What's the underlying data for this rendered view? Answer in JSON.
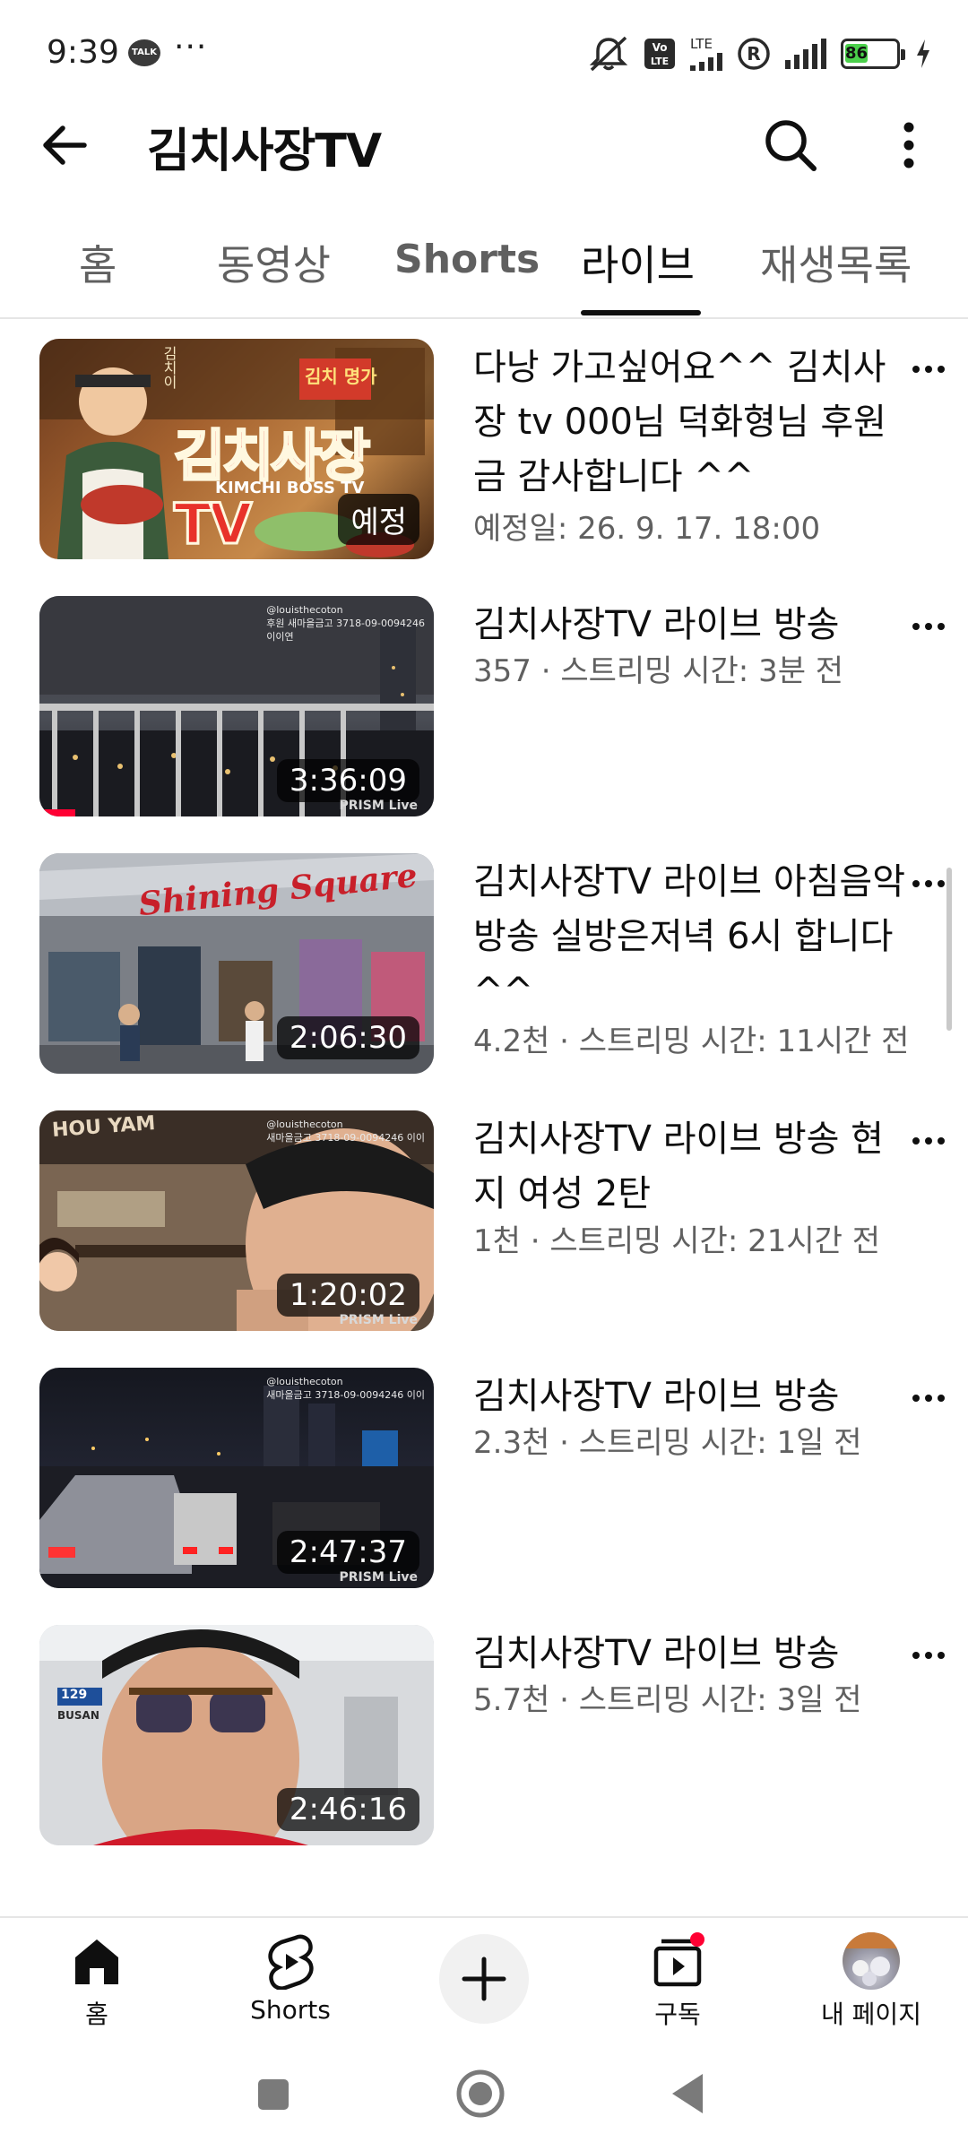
{
  "status_bar": {
    "time": "9:39",
    "talk_badge": "TALK",
    "more_dots": "···",
    "volte": "Vo LTE",
    "lte": "LTE",
    "battery": "86",
    "icons": [
      "kakaotalk-icon",
      "mute-icon",
      "volte-icon",
      "lte-signal-icon",
      "r-icon",
      "signal-icon",
      "battery-icon",
      "charging-icon"
    ]
  },
  "header": {
    "channel_title": "김치사장TV",
    "icons": [
      "back-arrow-icon",
      "search-icon",
      "more-vert-icon"
    ]
  },
  "tabs": [
    {
      "label": "홈",
      "active": false
    },
    {
      "label": "동영상",
      "active": false
    },
    {
      "label": "Shorts",
      "active": false
    },
    {
      "label": "라이브",
      "active": true
    },
    {
      "label": "재생목록",
      "active": false
    }
  ],
  "videos": [
    {
      "title": "다낭 가고싶어요^^ 김치사장 tv 000님 덕화형님 후원금 감사합니다 ^^",
      "meta": "예정일: 26. 9. 17. 18:00",
      "badge": "예정",
      "thumb_text": {
        "main": "김치사장TV",
        "sub": "KIMCHI BOSS TV",
        "sign": "김치 명가",
        "sign2": "김치이"
      }
    },
    {
      "title": "김치사장TV 라이브 방송",
      "meta": "357 · 스트리밍 시간: 3분 전",
      "badge": "3:36:09",
      "thumb_text": {
        "watermark": "@louisthecoton\n후원 새마을금고 3718-09-0094246\n이이연",
        "prism": "PRISM Live"
      }
    },
    {
      "title": "김치사장TV 라이브 아침음악방송  실방은저녁 6시 합니다^^",
      "meta": "4.2천 · 스트리밍 시간: 11시간 전",
      "badge": "2:06:30",
      "thumb_text": {
        "sign": "Shining Square"
      }
    },
    {
      "title": "김치사장TV 라이브 방송 현지 여성 2탄",
      "meta": "1천 · 스트리밍 시간: 21시간 전",
      "badge": "1:20:02",
      "thumb_text": {
        "watermark": "@louisthecoton\n새마을금고 3718-09-0094246 이이",
        "prism": "PRISM Live",
        "sign": "HOU YAM"
      }
    },
    {
      "title": "김치사장TV 라이브 방송",
      "meta": "2.3천 · 스트리밍 시간: 1일 전",
      "badge": "2:47:37",
      "thumb_text": {
        "watermark": "@louisthecoton\n새마을금고 3718-09-0094246 이이",
        "prism": "PRISM Live"
      }
    },
    {
      "title": "김치사장TV 라이브 방송",
      "meta": "5.7천 · 스트리밍 시간: 3일 전",
      "badge": "2:46:16",
      "thumb_text": {
        "sign": "BUSAN",
        "sign2": "129"
      }
    }
  ],
  "bottom_nav": [
    {
      "label": "홈",
      "icon": "home-filled-icon",
      "active": true
    },
    {
      "label": "Shorts",
      "icon": "shorts-icon",
      "active": false
    },
    {
      "label": "",
      "icon": "plus-icon",
      "active": false
    },
    {
      "label": "구독",
      "icon": "subscriptions-icon",
      "active": false,
      "has_notification_dot": true
    },
    {
      "label": "내 페이지",
      "icon": "avatar",
      "active": false
    }
  ],
  "system_nav": {
    "icons": [
      "recents-square-icon",
      "home-circle-icon",
      "back-triangle-icon"
    ]
  },
  "colors": {
    "accent_red": "#ff0033",
    "text_primary": "#0f0f0f",
    "text_secondary": "#606060",
    "battery_green": "#4bd04b"
  }
}
